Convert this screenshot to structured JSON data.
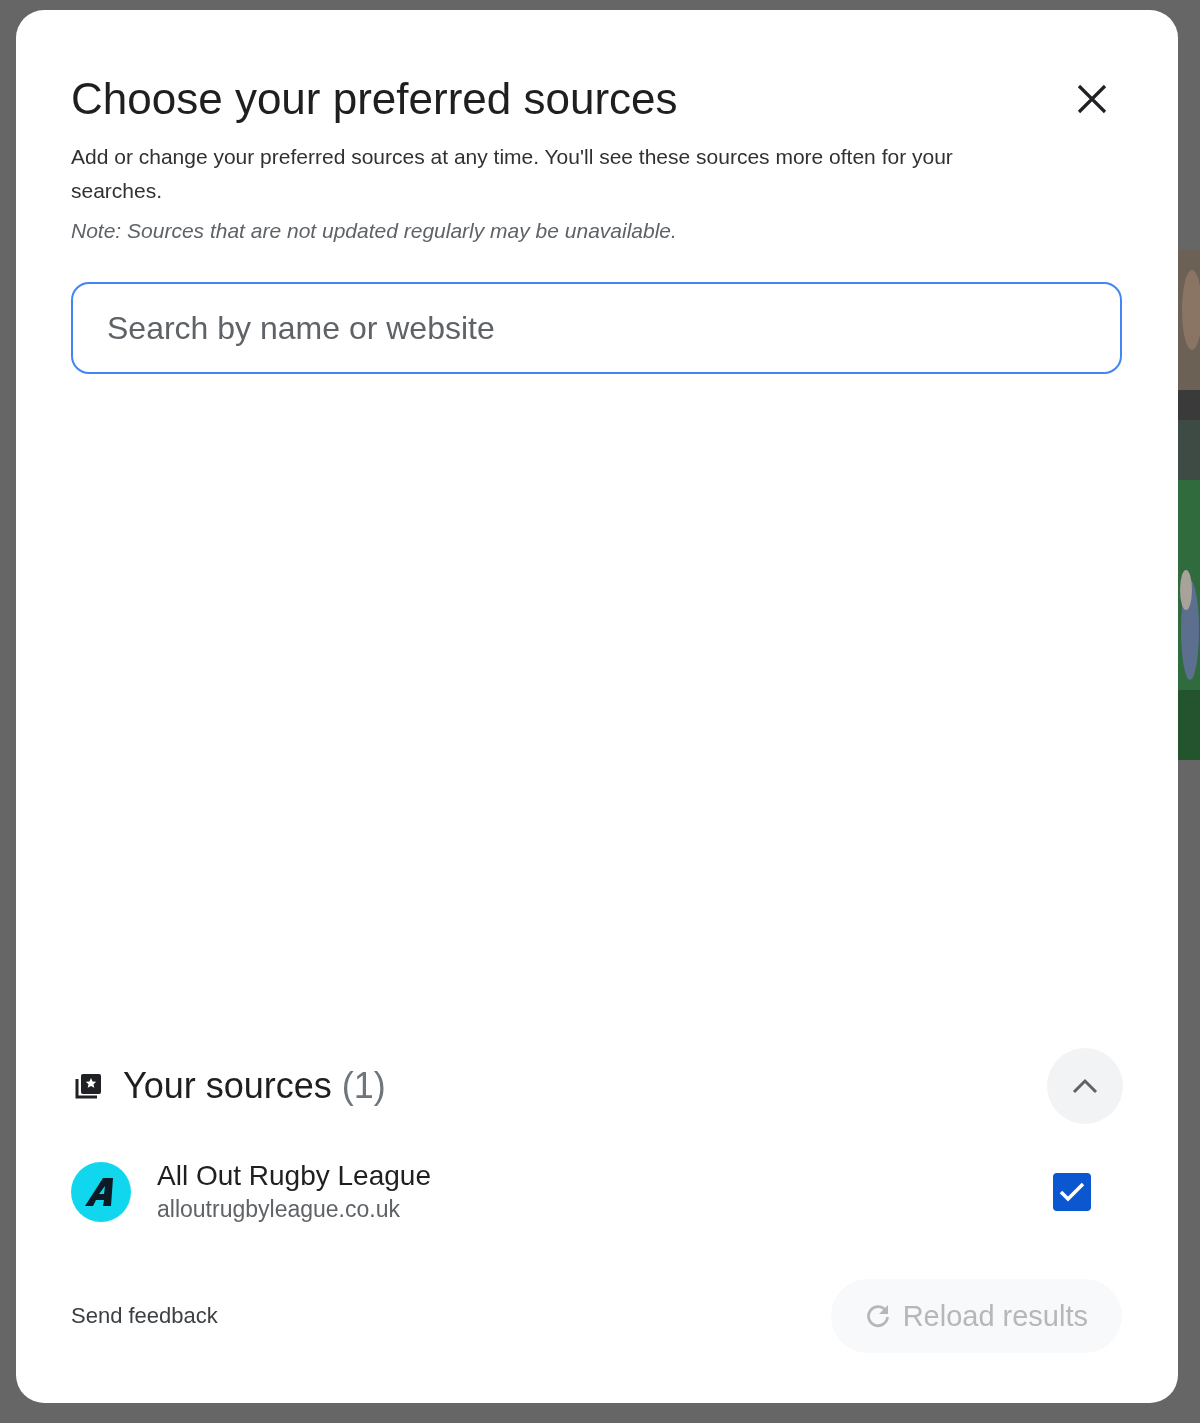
{
  "dialog": {
    "title": "Choose your preferred sources",
    "description": "Add or change your preferred sources at any time. You'll see these sources more often for your searches.",
    "note": "Note: Sources that are not updated regularly may be unavailable.",
    "search": {
      "placeholder": "Search by name or website"
    },
    "your_sources": {
      "label": "Your sources",
      "count": "(1)",
      "expanded": true
    },
    "sources": [
      {
        "name": "All Out Rugby League",
        "domain": "alloutrugbyleague.co.uk",
        "checked": true
      }
    ],
    "feedback_link": "Send feedback",
    "reload_button": {
      "label": "Reload results",
      "disabled": true
    }
  }
}
